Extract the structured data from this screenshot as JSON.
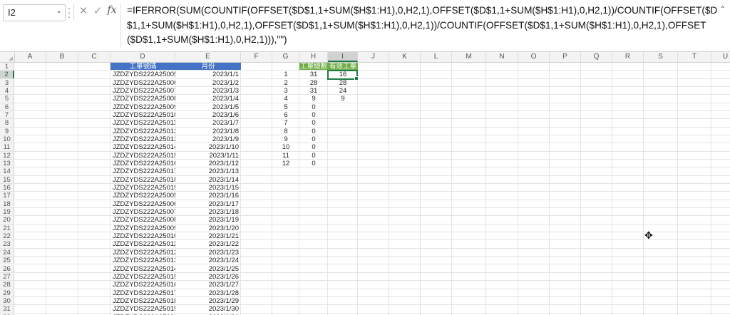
{
  "name_box": "I2",
  "formula": "=IFERROR(SUM(COUNTIF(OFFSET($D$1,1+SUM($H$1:H1),0,H2,1),OFFSET($D$1,1+SUM($H$1:H1),0,H2,1))/COUNTIF(OFFSET($D$1,1+SUM($H$1:H1),0,H2,1),OFFSET($D$1,1+SUM($H$1:H1),0,H2,1))/COUNTIF(OFFSET($D$1,1+SUM($H$1:H1),0,H2,1),OFFSET($D$1,1+SUM($H$1:H1),0,H2,1))),\"\")",
  "icons": {
    "cancel": "close-icon",
    "enter": "check-icon",
    "function": "fx-icon"
  },
  "columns": [
    "A",
    "B",
    "C",
    "D",
    "E",
    "F",
    "G",
    "H",
    "I",
    "J",
    "K",
    "L",
    "M",
    "N",
    "O",
    "P",
    "Q",
    "R",
    "S",
    "T",
    "U"
  ],
  "selected_column": "I",
  "selected_row": 2,
  "rows": [
    "1",
    "2",
    "3",
    "4",
    "5",
    "6",
    "7",
    "8",
    "9",
    "10",
    "11",
    "12",
    "13",
    "14",
    "15",
    "16",
    "17",
    "18",
    "19",
    "20",
    "21",
    "22",
    "23",
    "24",
    "25",
    "26",
    "27",
    "28",
    "29",
    "30",
    "31",
    "32"
  ],
  "table_de": {
    "headers": [
      "工單號碼",
      "月份"
    ],
    "rows": [
      [
        "JZDZYDS222A25005",
        "2023/1/1"
      ],
      [
        "JZDZYDS222A25006",
        "2023/1/2"
      ],
      [
        "JZDZYDS222A25007",
        "2023/1/3"
      ],
      [
        "JZDZYDS222A25008",
        "2023/1/4"
      ],
      [
        "JZDZYDS222A25009",
        "2023/1/5"
      ],
      [
        "JZDZYDS222A25010",
        "2023/1/6"
      ],
      [
        "JZDZYDS222A25011",
        "2023/1/7"
      ],
      [
        "JZDZYDS222A25012",
        "2023/1/8"
      ],
      [
        "JZDZYDS222A25013",
        "2023/1/9"
      ],
      [
        "JZDZYDS222A25014",
        "2023/1/10"
      ],
      [
        "JZDZYDS222A25015",
        "2023/1/11"
      ],
      [
        "JZDZYDS222A25016",
        "2023/1/12"
      ],
      [
        "JZDZYDS222A25017",
        "2023/1/13"
      ],
      [
        "JZDZYDS222A25018",
        "2023/1/14"
      ],
      [
        "JZDZYDS222A25019",
        "2023/1/15"
      ],
      [
        "JZDZYDS222A25005",
        "2023/1/16"
      ],
      [
        "JZDZYDS222A25006",
        "2023/1/17"
      ],
      [
        "JZDZYDS222A25007",
        "2023/1/18"
      ],
      [
        "JZDZYDS222A25008",
        "2023/1/19"
      ],
      [
        "JZDZYDS222A25009",
        "2023/1/20"
      ],
      [
        "JZDZYDS222A25010",
        "2023/1/21"
      ],
      [
        "JZDZYDS222A25011",
        "2023/1/22"
      ],
      [
        "JZDZYDS222A25012",
        "2023/1/23"
      ],
      [
        "JZDZYDS222A25013",
        "2023/1/24"
      ],
      [
        "JZDZYDS222A25014",
        "2023/1/25"
      ],
      [
        "JZDZYDS222A25015",
        "2023/1/26"
      ],
      [
        "JZDZYDS222A25016",
        "2023/1/27"
      ],
      [
        "JZDZYDS222A25017",
        "2023/1/28"
      ],
      [
        "JZDZYDS222A25018",
        "2023/1/29"
      ],
      [
        "JZDZYDS222A25019",
        "2023/1/30"
      ],
      [
        "JZDZYDS222A25020",
        "2023/1/31"
      ]
    ]
  },
  "table_ghi": {
    "headers": [
      "工單總數",
      "有效工單"
    ],
    "rows": [
      [
        "1",
        "31",
        "16"
      ],
      [
        "2",
        "28",
        "28"
      ],
      [
        "3",
        "31",
        "24"
      ],
      [
        "4",
        "9",
        "9"
      ],
      [
        "5",
        "0",
        ""
      ],
      [
        "6",
        "0",
        ""
      ],
      [
        "7",
        "0",
        ""
      ],
      [
        "8",
        "0",
        ""
      ],
      [
        "9",
        "0",
        ""
      ],
      [
        "10",
        "0",
        ""
      ],
      [
        "11",
        "0",
        ""
      ],
      [
        "12",
        "0",
        ""
      ]
    ]
  },
  "colors": {
    "header_blue": "#4472c4",
    "header_green": "#70ad47",
    "selection_green": "#1f7a45"
  }
}
